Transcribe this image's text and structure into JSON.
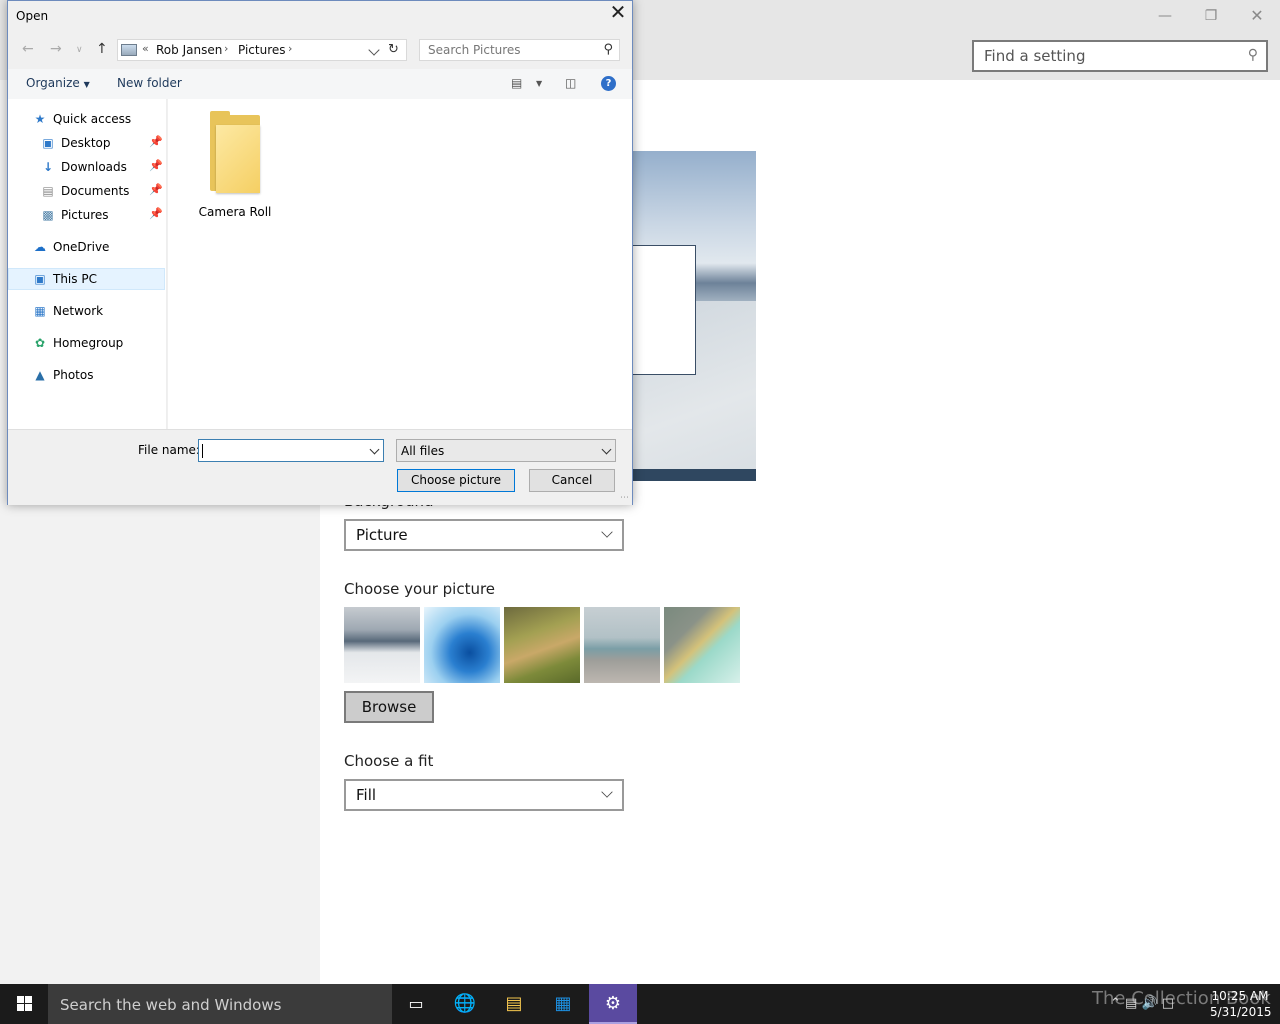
{
  "settings": {
    "search_placeholder": "Find a setting",
    "minimize_icon": "minimize-icon",
    "restore_icon": "restore-icon",
    "close_icon": "close-icon",
    "background_label": "Background",
    "background_value": "Picture",
    "choose_picture_label": "Choose your picture",
    "browse_label": "Browse",
    "fit_label": "Choose a fit",
    "fit_value": "Fill"
  },
  "dialog": {
    "title": "Open",
    "breadcrumb_prefix": "«",
    "breadcrumb": [
      "Rob Jansen",
      "Pictures"
    ],
    "search_placeholder": "Search Pictures",
    "toolbar": {
      "organize": "Organize",
      "new_folder": "New folder",
      "help": "?"
    },
    "nav": {
      "quick_access": "Quick access",
      "desktop": "Desktop",
      "downloads": "Downloads",
      "documents": "Documents",
      "pictures": "Pictures",
      "onedrive": "OneDrive",
      "this_pc": "This PC",
      "network": "Network",
      "homegroup": "Homegroup",
      "photos": "Photos"
    },
    "files": [
      {
        "name": "Camera Roll",
        "type": "folder"
      }
    ],
    "file_name_label": "File name:",
    "file_name_value": "",
    "file_type": "All files",
    "choose_button": "Choose picture",
    "cancel_button": "Cancel"
  },
  "taskbar": {
    "search_placeholder": "Search the web and Windows",
    "time": "10:25 AM",
    "date": "5/31/2015",
    "watermark": "The Collection Book"
  },
  "colors": {
    "accent": "#0078d7",
    "taskbar": "#1b1b1b",
    "settings_active_app": "#5a4aa0",
    "folder": "#f5cf63"
  }
}
